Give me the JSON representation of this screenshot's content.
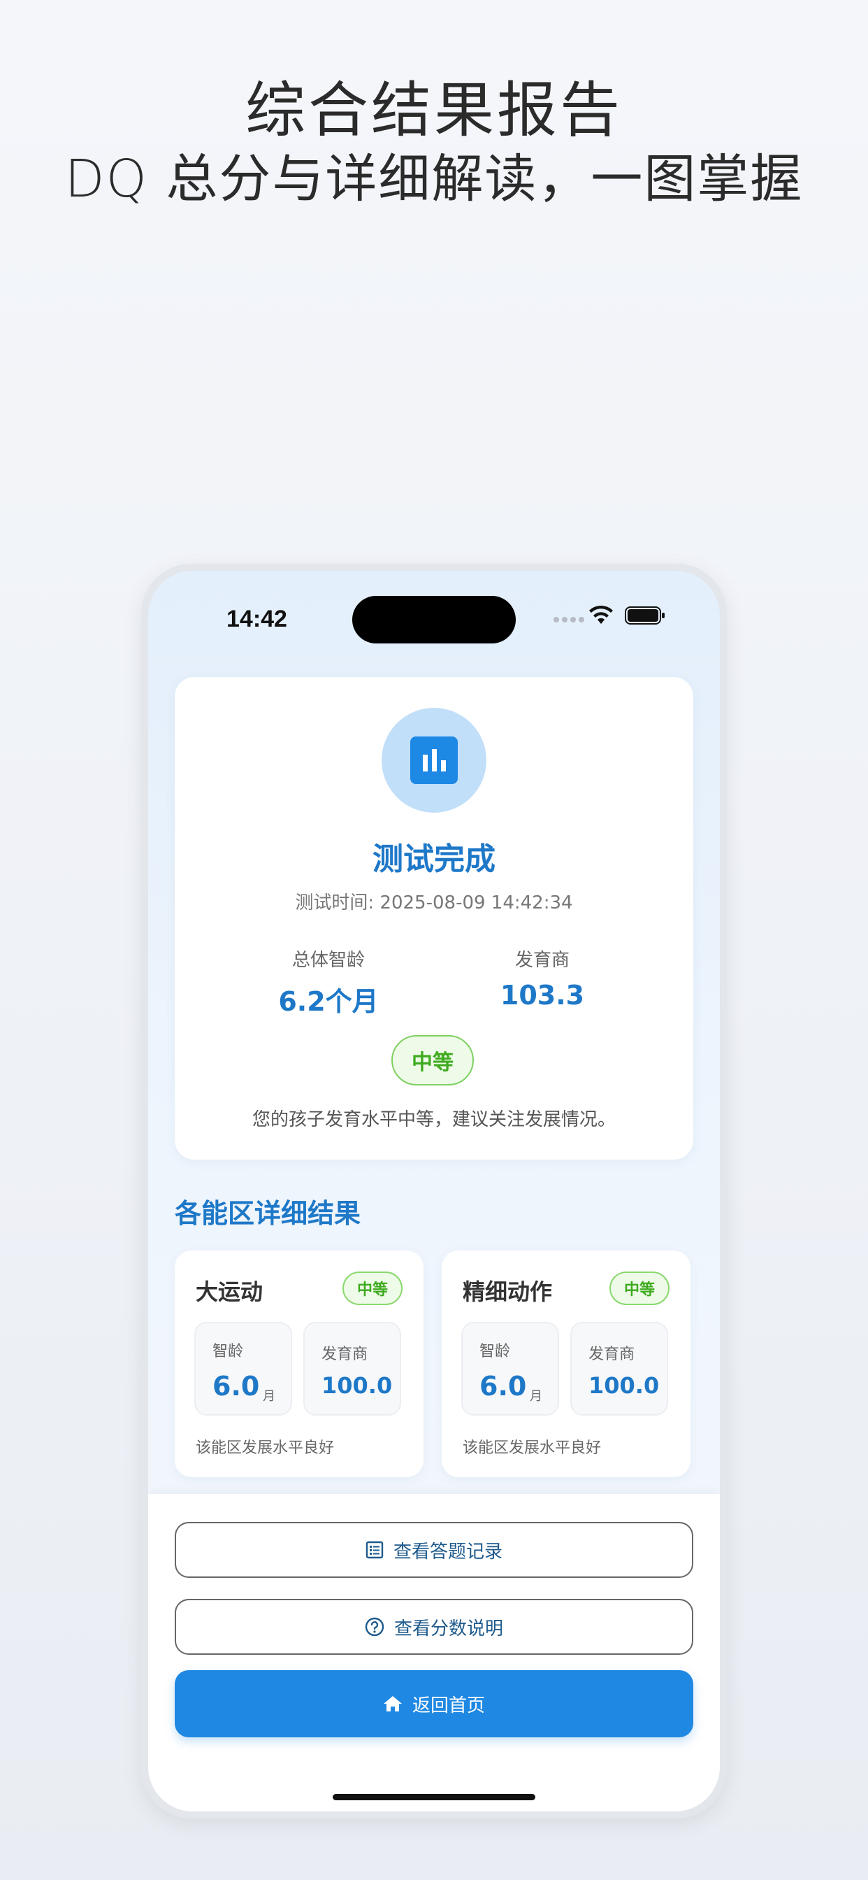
{
  "headline": {
    "line1": "综合结果报告",
    "line2": "DQ 总分与详细解读，一图掌握"
  },
  "status_bar": {
    "time": "14:42"
  },
  "result": {
    "icon": "bar-chart-icon",
    "title": "测试完成",
    "test_time": "测试时间: 2025-08-09 14:42:34",
    "overall_age_label": "总体智龄",
    "overall_age_value": "6.2个月",
    "dq_label": "发育商",
    "dq_value": "103.3",
    "level": "中等",
    "summary": "您的孩子发育水平中等，建议关注发展情况。"
  },
  "areas": {
    "title": "各能区详细结果",
    "items": [
      {
        "name": "大运动",
        "level": "中等",
        "age_label": "智龄",
        "age_value": "6.0",
        "age_unit": "月",
        "dq_label": "发育商",
        "dq_value": "100.0",
        "desc": "该能区发展水平良好"
      },
      {
        "name": "精细动作",
        "level": "中等",
        "age_label": "智龄",
        "age_value": "6.0",
        "age_unit": "月",
        "dq_label": "发育商",
        "dq_value": "100.0",
        "desc": "该能区发展水平良好"
      }
    ]
  },
  "actions": {
    "records_label": "查看答题记录",
    "records_icon": "list-icon",
    "explain_label": "查看分数说明",
    "explain_icon": "question-circle-icon",
    "home_label": "返回首页",
    "home_icon": "home-icon"
  },
  "colors": {
    "accent": "#1e78c8",
    "primary_button": "#1f88e2",
    "level_green": "#3eaa1f"
  }
}
